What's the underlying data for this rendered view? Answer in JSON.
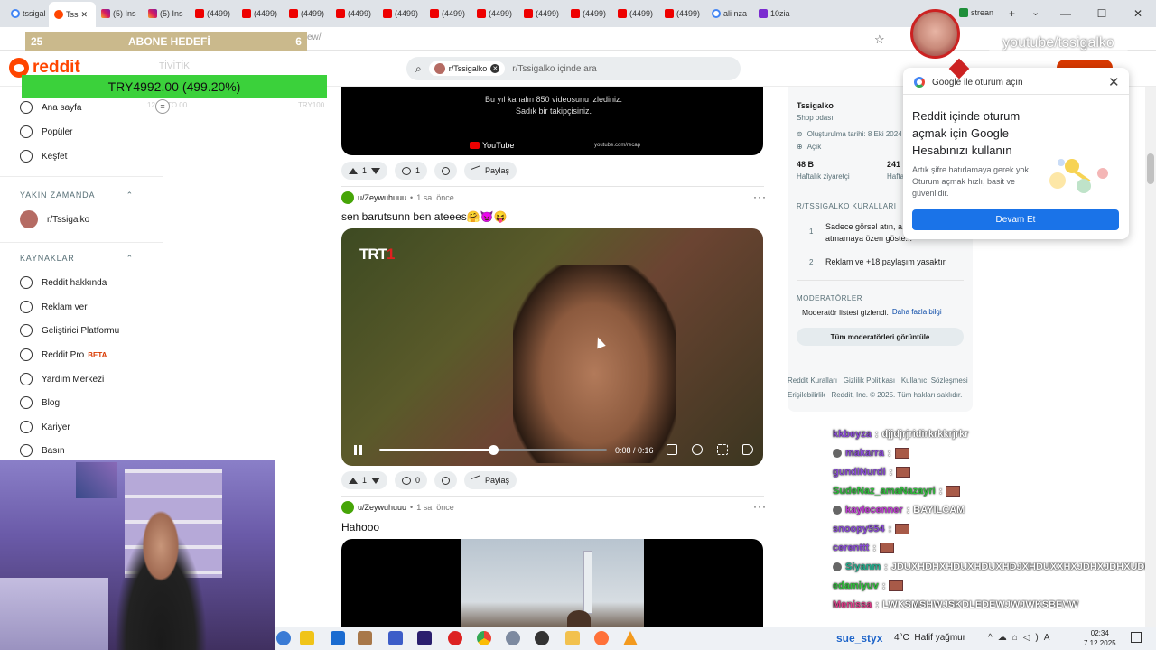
{
  "browser": {
    "tabs": [
      {
        "label": "tssigal",
        "icon": "g"
      },
      {
        "label": "Tss",
        "icon": "rd",
        "active": true
      },
      {
        "label": "(5) Ins",
        "icon": "ig"
      },
      {
        "label": "(5) Ins",
        "icon": "ig"
      },
      {
        "label": "(4499)",
        "icon": "yt"
      },
      {
        "label": "(4499)",
        "icon": "yt"
      },
      {
        "label": "(4499)",
        "icon": "yt"
      },
      {
        "label": "(4499)",
        "icon": "yt"
      },
      {
        "label": "(4499)",
        "icon": "yt"
      },
      {
        "label": "(4499)",
        "icon": "yt"
      },
      {
        "label": "(4499)",
        "icon": "yt"
      },
      {
        "label": "(4499)",
        "icon": "yt"
      },
      {
        "label": "(4499)",
        "icon": "yt"
      },
      {
        "label": "(4499)",
        "icon": "yt"
      },
      {
        "label": "(4499)",
        "icon": "yt"
      },
      {
        "label": "ali nza",
        "icon": "g"
      },
      {
        "label": "10zia",
        "icon": "tw"
      }
    ],
    "url_fragment": "ew/",
    "stream_tab": "strean"
  },
  "overlay": {
    "abone_left": "25",
    "abone_title": "ABONE HEDEFİ",
    "abone_right": "6",
    "try_text": "TRY4992.00 (499.20%)",
    "ghost_top": "TİVİTİK",
    "ghost_left": "12.05 TO 00",
    "ghost_right": "TRY100",
    "yt_handle": "youtube/tssigalko"
  },
  "reddit": {
    "logo": "reddit",
    "search_chip": "r/Tssigalko",
    "search_placeholder": "r/Tssigalko içinde ara"
  },
  "sidebar": {
    "items": [
      {
        "label": "Ana sayfa",
        "icon": "home-icon"
      },
      {
        "label": "Popüler",
        "icon": "popular-icon"
      },
      {
        "label": "Keşfet",
        "icon": "explore-icon"
      }
    ],
    "recent_title": "YAKIN ZAMANDA",
    "recent_items": [
      {
        "label": "r/Tssigalko"
      }
    ],
    "resources_title": "KAYNAKLAR",
    "resources": [
      {
        "label": "Reddit hakkında",
        "icon": "reddit-about-icon"
      },
      {
        "label": "Reklam ver",
        "icon": "advertise-icon"
      },
      {
        "label": "Geliştirici Platformu",
        "icon": "developer-icon"
      },
      {
        "label": "Reddit Pro",
        "icon": "pro-icon",
        "badge": "BETA"
      },
      {
        "label": "Yardım Merkezi",
        "icon": "help-icon"
      },
      {
        "label": "Blog",
        "icon": "blog-icon"
      },
      {
        "label": "Kariyer",
        "icon": "career-icon"
      },
      {
        "label": "Basın",
        "icon": "press-icon"
      }
    ]
  },
  "feed": {
    "post1": {
      "video_text": "Bu yıl kanalın 850 videosunu izlediniz. Sadık bir takipçisiniz.",
      "video_brand": "YouTube",
      "video_url": "youtube.com/recap",
      "votes": "1",
      "comments": "1",
      "share": "Paylaş"
    },
    "post2": {
      "user": "u/Zeywuhuuu",
      "time": "1 sa. önce",
      "title": "sen barutsunn ben ateees🤗😈😝",
      "channel_logo_a": "TRT",
      "channel_logo_b": "1",
      "video_time": "0:08 / 0:16",
      "progress": 0.5,
      "votes": "1",
      "comments": "0",
      "share": "Paylaş"
    },
    "post3": {
      "user": "u/Zeywuhuuu",
      "time": "1 sa. önce",
      "title": "Hahooo"
    }
  },
  "right_panel": {
    "name": "Tssigalko",
    "desc": "Shop odası",
    "created": "Oluşturulma tarihi: 8 Eki 2024",
    "status": "Açık",
    "visitors_value": "48 B",
    "visitors_label": "Haftalık ziyaretçi",
    "contrib_value": "241",
    "contrib_label": "Haftalık",
    "rules_title": "R/TSSIGALKO KURALLARI",
    "rules": [
      {
        "n": "1",
        "text": "Sadece görsel atın, a... atmamaya özen göste..."
      },
      {
        "n": "2",
        "text": "Reklam ve +18 paylaşım yasaktır."
      }
    ],
    "mods_title": "MODERATÖRLER",
    "mods_text": "Moderatör listesi gizlendi.",
    "mods_link": "Daha fazla bilgi",
    "mods_button": "Tüm moderatörleri görüntüle",
    "footer_line1": "Reddit Kuralları   Gizlilik Politikası   Kullanıcı Sözleşmesi",
    "footer_line2": "Erişilebilirlik   Reddit, Inc. © 2025. Tüm hakları saklıdır."
  },
  "google_popup": {
    "header": "Google ile oturum açın",
    "title": "Reddit içinde oturum açmak için Google Hesabınızı kullanın",
    "body": "Artık şifre hatırlamaya gerek yok. Oturum açmak hızlı, basit ve güvenlidir.",
    "button": "Devam Et"
  },
  "chat": [
    {
      "user": "kkbeyza",
      "text": "djjdjrjridirkrkkrjrkr",
      "color": "#8a4bd6"
    },
    {
      "user": "makarra",
      "text": "",
      "color": "#8a4bd6",
      "emote": true
    },
    {
      "user": "gundiNurdi",
      "text": "",
      "color": "#8a4bd6",
      "emote": true
    },
    {
      "user": "SudeNaz_amaNazayri",
      "text": "",
      "color": "#2fbf3b",
      "emote": true
    },
    {
      "user": "kaylecenner",
      "text": "BAYILCAM",
      "color": "#c23bd6"
    },
    {
      "user": "snoopy554",
      "text": "",
      "color": "#8a4bd6",
      "emote": true
    },
    {
      "user": "cerenttt",
      "text": "",
      "color": "#8a4bd6",
      "emote": true
    },
    {
      "user": "Siyanm",
      "text": "JDUXHDHXHDUXHDUXHDJXHDUXXHXJDHXJDHXUDFHXJXX",
      "color": "#22b08f"
    },
    {
      "user": "edamiyuv",
      "text": "",
      "color": "#2fbf3b",
      "emote": true
    },
    {
      "user": "Menissa",
      "text": "LWKSMSHWJSKDLEDEWJWJWKSBEVW",
      "color": "#e03b8a"
    }
  ],
  "taskbar": {
    "chat_user": "sue_styx",
    "weather_temp": "4°C",
    "weather_text": "Hafif yağmur",
    "time": "02:34",
    "date": "7.12.2025"
  }
}
